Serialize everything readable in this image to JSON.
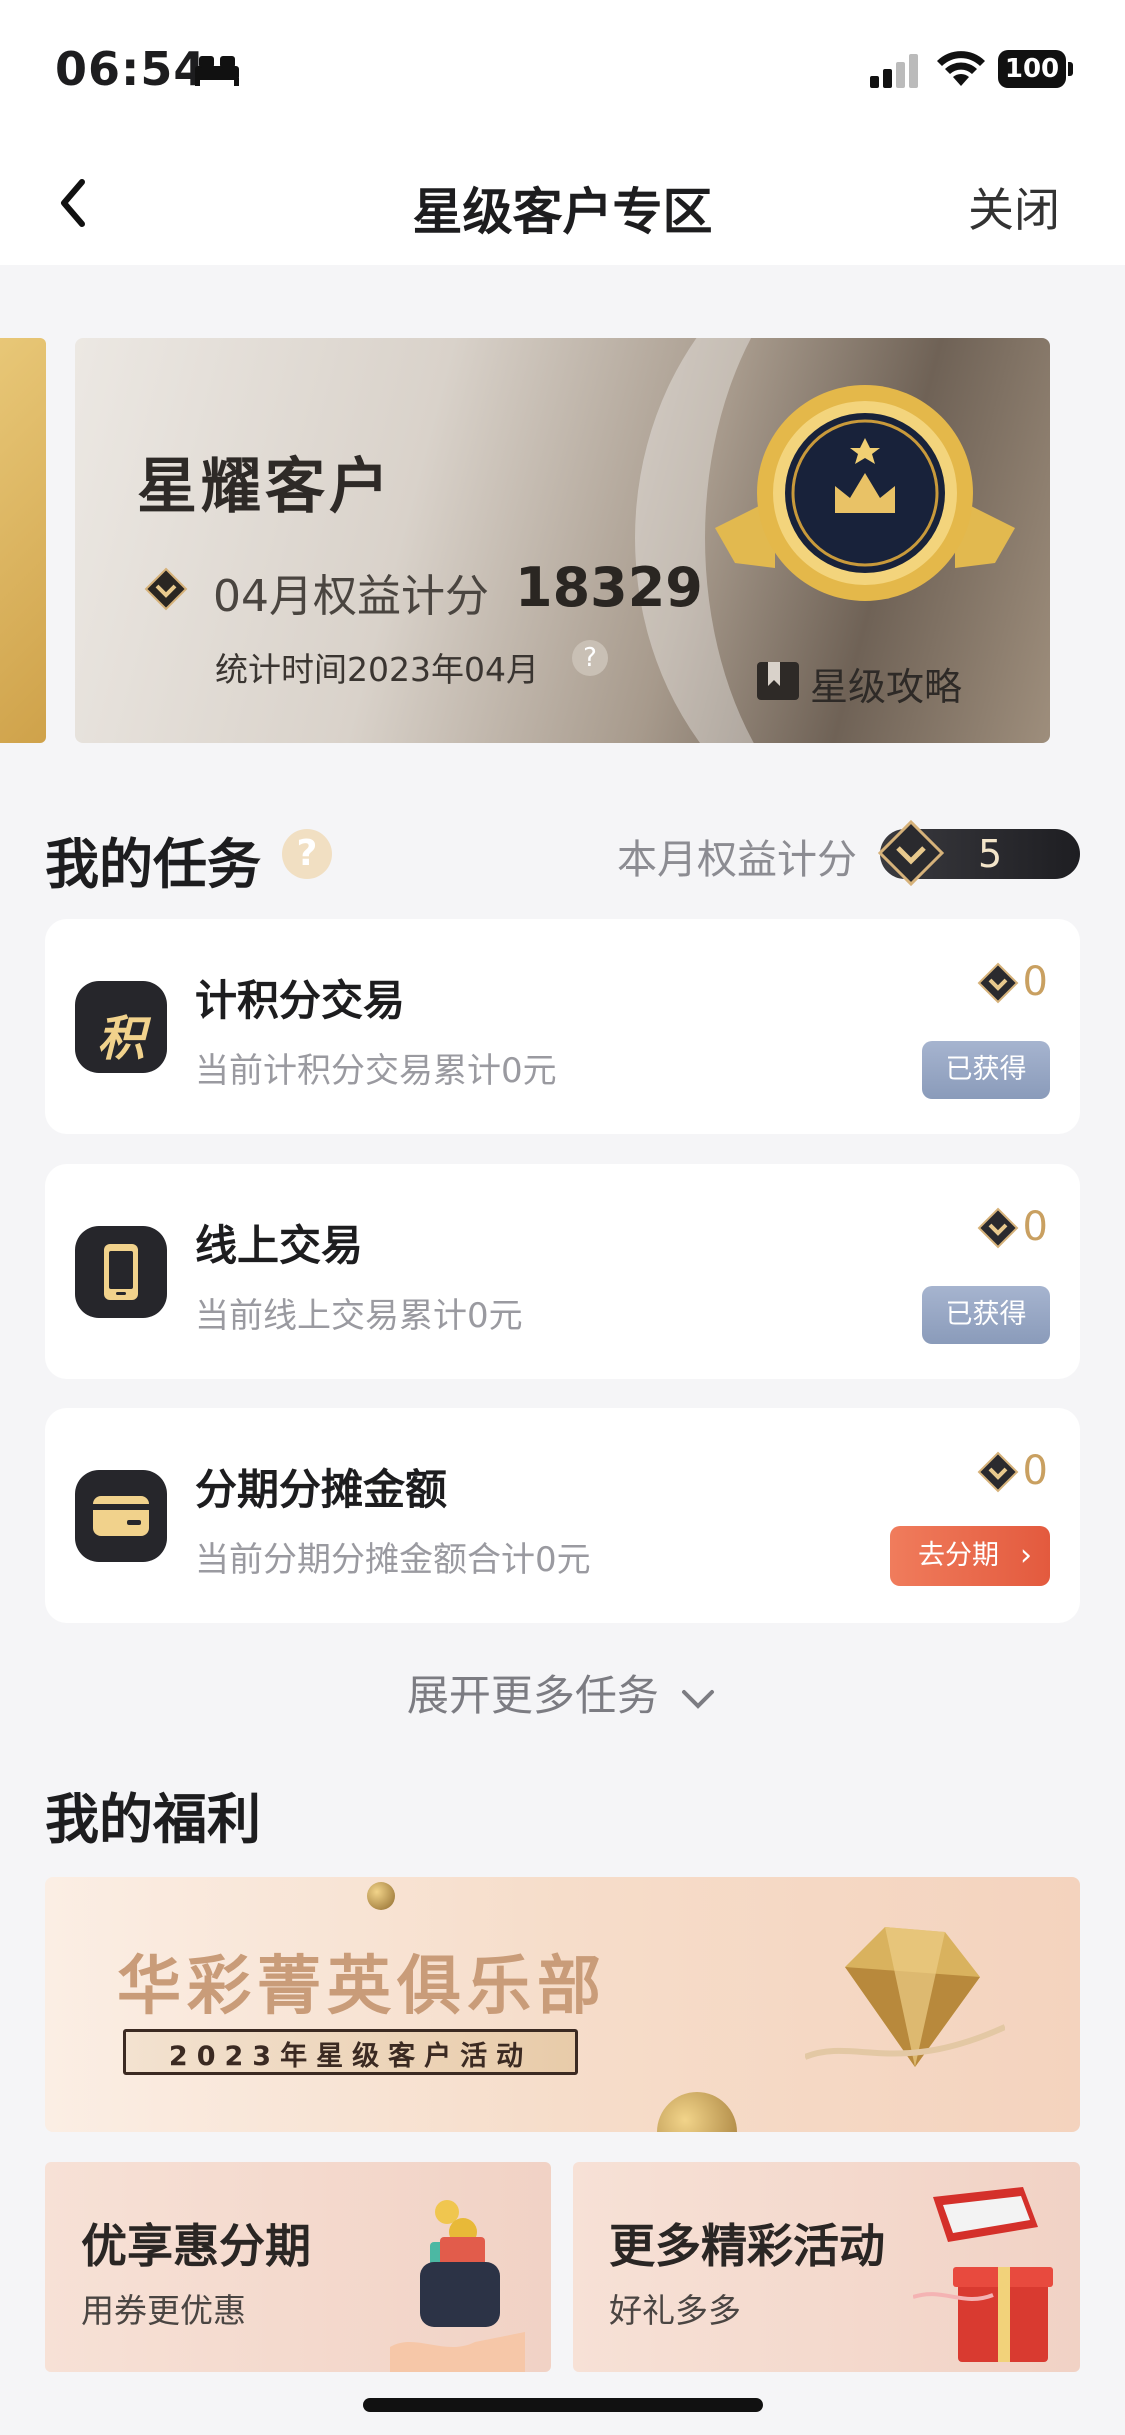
{
  "status_bar": {
    "time": "06:54",
    "battery": "100"
  },
  "nav": {
    "title": "星级客户专区",
    "close_label": "关闭"
  },
  "star_card": {
    "level": "星耀客户",
    "points_label": "04月权益计分",
    "points_value": "18329",
    "stat_time": "统计时间2023年04月",
    "guide_label": "星级攻略"
  },
  "tasks": {
    "section_title": "我的任务",
    "month_label": "本月权益计分",
    "month_points": "5",
    "items": [
      {
        "icon": "points-icon",
        "icon_char": "积",
        "title": "计积分交易",
        "desc": "当前计积分交易累计0元",
        "score": "0",
        "action": "已获得"
      },
      {
        "icon": "phone-icon",
        "title": "线上交易",
        "desc": "当前线上交易累计0元",
        "score": "0",
        "action": "已获得"
      },
      {
        "icon": "card-icon",
        "title": "分期分摊金额",
        "desc": "当前分期分摊金额合计0元",
        "score": "0",
        "action": "去分期"
      }
    ],
    "expand_label": "展开更多任务"
  },
  "welfare": {
    "section_title": "我的福利",
    "banner_title": "华彩菁英俱乐部",
    "banner_subtitle": "2023年星级客户活动",
    "promos": [
      {
        "title": "优享惠分期",
        "subtitle": "用券更优惠"
      },
      {
        "title": "更多精彩活动",
        "subtitle": "好礼多多"
      }
    ]
  },
  "colors": {
    "gold": "#c9a061",
    "got_button": "#8a9bba",
    "go_button": "#e35a3e"
  }
}
